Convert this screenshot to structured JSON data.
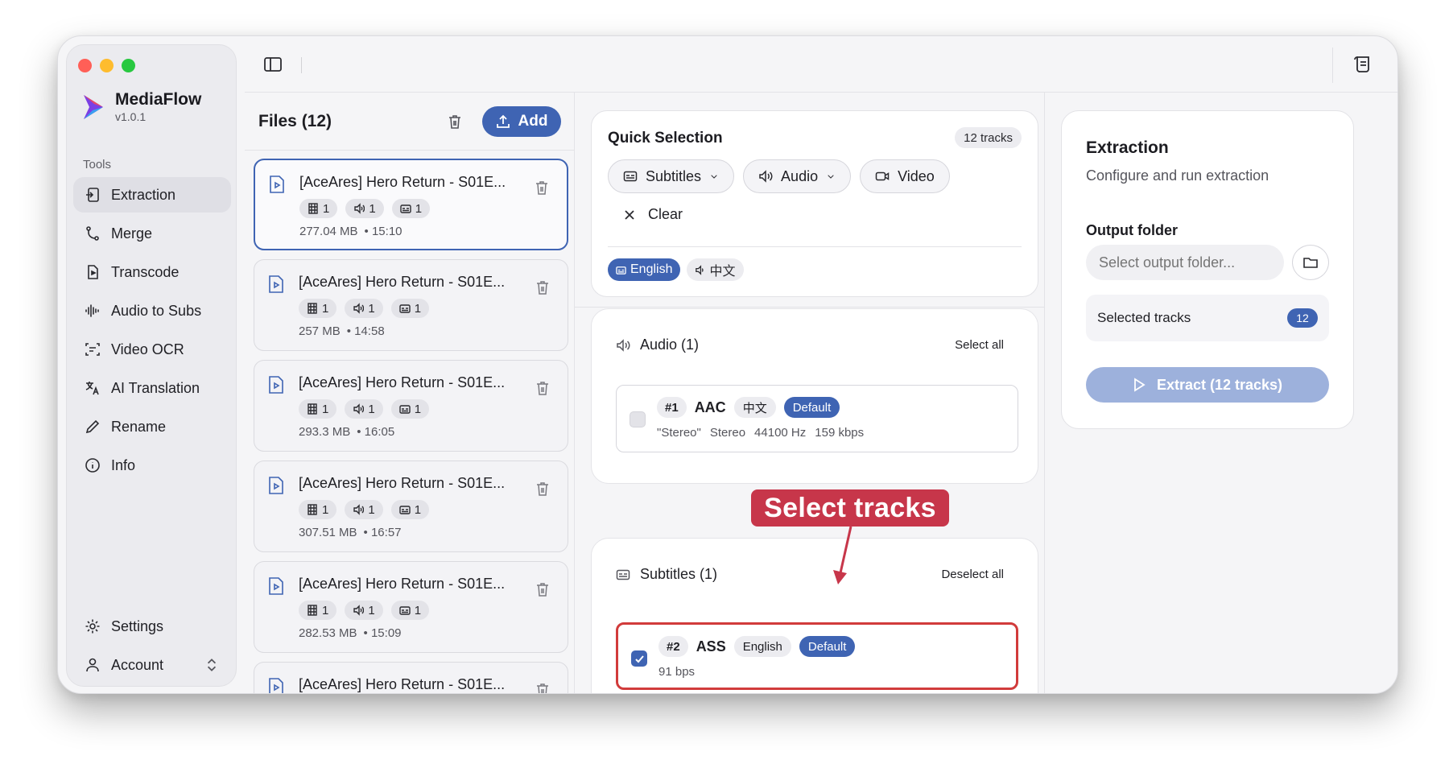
{
  "app": {
    "name": "MediaFlow",
    "version": "v1.0.1"
  },
  "sidebar": {
    "section_label": "Tools",
    "items": [
      {
        "label": "Extraction",
        "icon": "extraction-icon",
        "active": true
      },
      {
        "label": "Merge",
        "icon": "merge-icon"
      },
      {
        "label": "Transcode",
        "icon": "transcode-icon"
      },
      {
        "label": "Audio to Subs",
        "icon": "waveform-icon"
      },
      {
        "label": "Video OCR",
        "icon": "ocr-icon"
      },
      {
        "label": "AI Translation",
        "icon": "translate-icon"
      },
      {
        "label": "Rename",
        "icon": "pencil-icon"
      },
      {
        "label": "Info",
        "icon": "info-icon"
      }
    ],
    "settings_label": "Settings",
    "account_label": "Account"
  },
  "files": {
    "title": "Files (12)",
    "add_label": "Add",
    "items": [
      {
        "name": "[AceAres] Hero Return - S01E...",
        "video": "1",
        "audio": "1",
        "subs": "1",
        "size": "277.04 MB",
        "duration": "• 15:10",
        "selected": true
      },
      {
        "name": "[AceAres] Hero Return - S01E...",
        "video": "1",
        "audio": "1",
        "subs": "1",
        "size": "257 MB",
        "duration": "• 14:58"
      },
      {
        "name": "[AceAres] Hero Return - S01E...",
        "video": "1",
        "audio": "1",
        "subs": "1",
        "size": "293.3 MB",
        "duration": "• 16:05"
      },
      {
        "name": "[AceAres] Hero Return - S01E...",
        "video": "1",
        "audio": "1",
        "subs": "1",
        "size": "307.51 MB",
        "duration": "• 16:57"
      },
      {
        "name": "[AceAres] Hero Return - S01E...",
        "video": "1",
        "audio": "1",
        "subs": "1",
        "size": "282.53 MB",
        "duration": "• 15:09"
      },
      {
        "name": "[AceAres] Hero Return - S01E..."
      }
    ]
  },
  "quick_selection": {
    "title": "Quick Selection",
    "count": "12 tracks",
    "subtitles_label": "Subtitles",
    "audio_label": "Audio",
    "video_label": "Video",
    "clear_label": "Clear",
    "lang_english": "English",
    "lang_chinese": "中文"
  },
  "audio_section": {
    "title": "Audio (1)",
    "action": "Select all",
    "track": {
      "num": "#1",
      "codec": "AAC",
      "lang": "中文",
      "default": "Default",
      "name": "\"Stereo\"",
      "channels": "Stereo",
      "rate": "44100 Hz",
      "bitrate": "159 kbps",
      "checked": false
    }
  },
  "subs_section": {
    "title": "Subtitles (1)",
    "action": "Deselect all",
    "track": {
      "num": "#2",
      "codec": "ASS",
      "lang": "English",
      "default": "Default",
      "bitrate": "91 bps",
      "checked": true
    }
  },
  "annotation": {
    "text": "Select tracks",
    "color": "#c7364a"
  },
  "extraction": {
    "title": "Extraction",
    "subtitle": "Configure and run extraction",
    "output_label": "Output folder",
    "output_placeholder": "Select output folder...",
    "selected_label": "Selected tracks",
    "selected_count": "12",
    "extract_label": "Extract (12 tracks)"
  },
  "colors": {
    "accent": "#3f64b3",
    "highlight": "#d13b3b"
  }
}
